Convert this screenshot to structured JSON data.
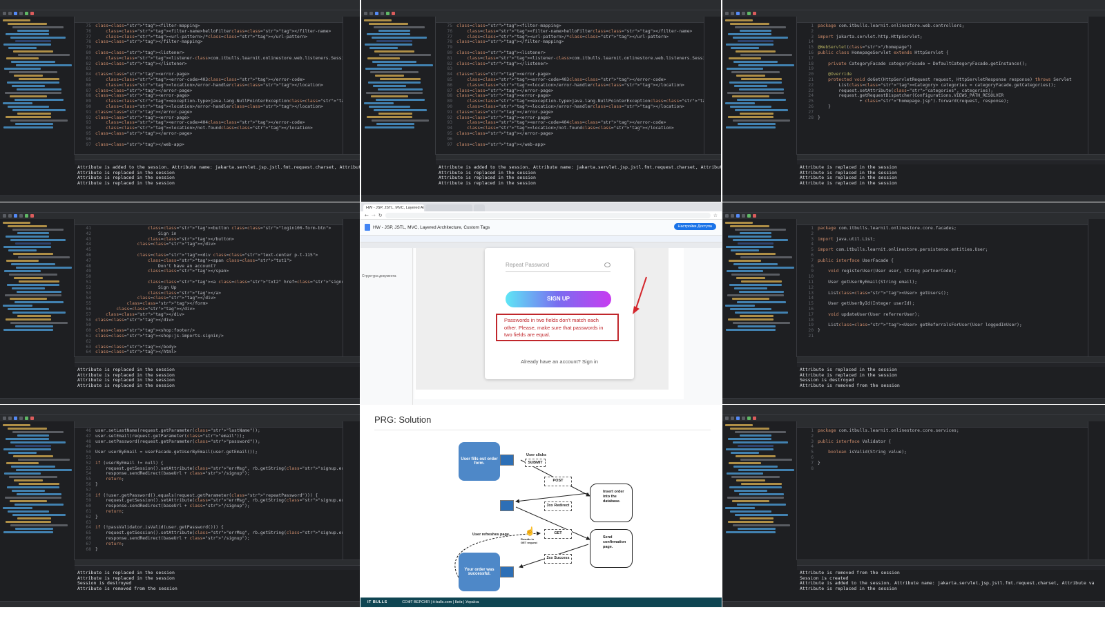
{
  "panels": {
    "ide1": {
      "code": [
        {
          "n": "75",
          "t": "<filter-mapping>"
        },
        {
          "n": "76",
          "t": "    <filter-name>helloFilter</filter-name>"
        },
        {
          "n": "77",
          "t": "    <url-pattern>/*</url-pattern>"
        },
        {
          "n": "78",
          "t": "</filter-mapping>"
        },
        {
          "n": "79",
          "t": ""
        },
        {
          "n": "80",
          "t": "<listener>"
        },
        {
          "n": "81",
          "t": "    <listener-class>com.itbulls.learnit.onlinestore.web.listeners.SessionListener</listener-c"
        },
        {
          "n": "82",
          "t": "</listener>"
        },
        {
          "n": "83",
          "t": ""
        },
        {
          "n": "84",
          "t": "<error-page>"
        },
        {
          "n": "85",
          "t": "    <error-code>403</error-code>"
        },
        {
          "n": "86",
          "t": "    <location>/error-handler</location>"
        },
        {
          "n": "87",
          "t": "</error-page>"
        },
        {
          "n": "88",
          "t": "<error-page>"
        },
        {
          "n": "89",
          "t": "    <exception-type>java.lang.NullPointerException</exception-type>"
        },
        {
          "n": "90",
          "t": "    <location>/error-handler</location>"
        },
        {
          "n": "91",
          "t": "</error-page>"
        },
        {
          "n": "92",
          "t": "<error-page>"
        },
        {
          "n": "93",
          "t": "    <error-code>404</error-code>"
        },
        {
          "n": "94",
          "t": "    <location>/not-found</location>"
        },
        {
          "n": "95",
          "t": "</error-page>"
        },
        {
          "n": "96",
          "t": ""
        },
        {
          "n": "97",
          "t": "</web-app>"
        }
      ],
      "console": [
        "Attribute is added to the session. Attribute name: jakarta.servlet.jsp.jstl.fmt.request.charset, Attribute val",
        "Attribute is replaced in the session",
        "Attribute is replaced in the session",
        "Attribute is replaced in the session"
      ]
    },
    "ide2": {
      "code": [
        {
          "n": "75",
          "t": "<filter-mapping>"
        },
        {
          "n": "76",
          "t": "    <filter-name>helloFilter</filter-name>"
        },
        {
          "n": "77",
          "t": "    <url-pattern>/*</url-pattern>"
        },
        {
          "n": "78",
          "t": "</filter-mapping>"
        },
        {
          "n": "79",
          "t": ""
        },
        {
          "n": "80",
          "t": "<listener>"
        },
        {
          "n": "81",
          "t": "    <listener-class>com.itbulls.learnit.onlinestore.web.listeners.SessionListener</listener-c"
        },
        {
          "n": "82",
          "t": "</listener>"
        },
        {
          "n": "83",
          "t": ""
        },
        {
          "n": "84",
          "t": "<error-page>"
        },
        {
          "n": "85",
          "t": "    <error-code>403</error-code>"
        },
        {
          "n": "86",
          "t": "    <location>/error-handler</location>"
        },
        {
          "n": "87",
          "t": "</error-page>"
        },
        {
          "n": "88",
          "t": "<error-page>"
        },
        {
          "n": "89",
          "t": "    <exception-type>java.lang.NullPointerException</exception-type>"
        },
        {
          "n": "90",
          "t": "    <location>/error-handler</location>"
        },
        {
          "n": "91",
          "t": "</error-page>"
        },
        {
          "n": "92",
          "t": "<error-page>"
        },
        {
          "n": "93",
          "t": "    <error-code>404</error-code>"
        },
        {
          "n": "94",
          "t": "    <location>/not-found</location>"
        },
        {
          "n": "95",
          "t": "</error-page>"
        },
        {
          "n": "96",
          "t": ""
        },
        {
          "n": "97",
          "t": "</web-app>"
        }
      ],
      "console": [
        "Attribute is added to the session. Attribute name: jakarta.servlet.jsp.jstl.fmt.request.charset, Attribute val",
        "Attribute is replaced in the session",
        "Attribute is replaced in the session",
        "Attribute is replaced in the session"
      ]
    },
    "ide3": {
      "code": [
        {
          "n": "1",
          "t": "package com.itbulls.learnit.onlinestore.web.controllers;"
        },
        {
          "n": "2",
          "t": ""
        },
        {
          "n": "3",
          "t": "import jakarta.servlet.http.HttpServlet;"
        },
        {
          "n": "14",
          "t": ""
        },
        {
          "n": "15",
          "t": "@WebServlet(\"/homepage\")"
        },
        {
          "n": "16",
          "t": "public class HomepageServlet extends HttpServlet {"
        },
        {
          "n": "17",
          "t": ""
        },
        {
          "n": "18",
          "t": "    private CategoryFacade categoryFacade = DefaultCategoryFacade.getInstance();"
        },
        {
          "n": "19",
          "t": ""
        },
        {
          "n": "20",
          "t": "    @Override"
        },
        {
          "n": "21",
          "t": "    protected void doGet(HttpServletRequest request, HttpServletResponse response) throws Servlet"
        },
        {
          "n": "22",
          "t": "        List<Category> categories = categoryFacade.getCategories();"
        },
        {
          "n": "23",
          "t": "        request.setAttribute(\"categories\", categories);"
        },
        {
          "n": "24",
          "t": "        request.getRequestDispatcher(Configurations.VIEWS_PATH_RESOLVER"
        },
        {
          "n": "25",
          "t": "                + \"homepage.jsp\").forward(request, response);"
        },
        {
          "n": "26",
          "t": "    }"
        },
        {
          "n": "27",
          "t": ""
        },
        {
          "n": "28",
          "t": "}"
        }
      ],
      "console": [
        "Attribute is replaced in the session",
        "Attribute is replaced in the session",
        "Attribute is replaced in the session",
        "Attribute is replaced in the session"
      ]
    },
    "ide4": {
      "code": [
        {
          "n": "41",
          "t": "                    <button class=\"login100-form-btn\">"
        },
        {
          "n": "42",
          "t": "                        Sign in"
        },
        {
          "n": "43",
          "t": "                    </button>"
        },
        {
          "n": "44",
          "t": "                </div>"
        },
        {
          "n": "45",
          "t": ""
        },
        {
          "n": "46",
          "t": "                <div class=\"text-center p-t-115\">"
        },
        {
          "n": "47",
          "t": "                    <span class=\"txt1\">"
        },
        {
          "n": "48",
          "t": "                        Don't have an account?"
        },
        {
          "n": "49",
          "t": "                    </span>"
        },
        {
          "n": "50",
          "t": ""
        },
        {
          "n": "51",
          "t": "                    <a class=\"txt2\" href=\"signup.html\">"
        },
        {
          "n": "52",
          "t": "                        Sign Up"
        },
        {
          "n": "53",
          "t": "                    </a>"
        },
        {
          "n": "54",
          "t": "                </div>"
        },
        {
          "n": "55",
          "t": "            </form>"
        },
        {
          "n": "56",
          "t": "        </div>"
        },
        {
          "n": "57",
          "t": "    </div>"
        },
        {
          "n": "58",
          "t": "</div>"
        },
        {
          "n": "59",
          "t": ""
        },
        {
          "n": "60",
          "t": "<shop:footer/>"
        },
        {
          "n": "61",
          "t": "<shop:js-imports-signin/>"
        },
        {
          "n": "62",
          "t": ""
        },
        {
          "n": "63",
          "t": "</body>"
        },
        {
          "n": "64",
          "t": "</html>"
        }
      ],
      "console": [
        "Attribute is replaced in the session",
        "Attribute is replaced in the session",
        "Attribute is replaced in the session",
        "Attribute is replaced in the session"
      ]
    },
    "ide5": {
      "code": [
        {
          "n": "1",
          "t": "package com.itbulls.learnit.onlinestore.core.facades;"
        },
        {
          "n": "2",
          "t": ""
        },
        {
          "n": "3",
          "t": "import java.util.List;"
        },
        {
          "n": "4",
          "t": ""
        },
        {
          "n": "5",
          "t": "import com.itbulls.learnit.onlinestore.persistence.entities.User;"
        },
        {
          "n": "6",
          "t": ""
        },
        {
          "n": "7",
          "t": "public interface UserFacade {"
        },
        {
          "n": "8",
          "t": ""
        },
        {
          "n": "9",
          "t": "    void registerUser(User user, String partnerCode);"
        },
        {
          "n": "10",
          "t": ""
        },
        {
          "n": "11",
          "t": "    User getUserByEmail(String email);"
        },
        {
          "n": "12",
          "t": ""
        },
        {
          "n": "13",
          "t": "    List<User> getUsers();"
        },
        {
          "n": "14",
          "t": ""
        },
        {
          "n": "15",
          "t": "    User getUserById(Integer userId);"
        },
        {
          "n": "16",
          "t": ""
        },
        {
          "n": "17",
          "t": "    void updateUser(User referrerUser);"
        },
        {
          "n": "18",
          "t": ""
        },
        {
          "n": "19",
          "t": "    List<User> getReferralsForUser(User loggedInUser);"
        },
        {
          "n": "20",
          "t": "}"
        },
        {
          "n": "21",
          "t": ""
        }
      ],
      "console": [
        "Attribute is replaced in the session",
        "Attribute is replaced in the session",
        "Session is destroyed",
        "Attribute is removed from the session"
      ]
    },
    "ide6": {
      "code": [
        {
          "n": "46",
          "t": "user.setLastName(request.getParameter(\"lastName\"));"
        },
        {
          "n": "47",
          "t": "user.setEmail(request.getParameter(\"email\"));"
        },
        {
          "n": "48",
          "t": "user.setPassword(request.getParameter(\"password\"));"
        },
        {
          "n": "49",
          "t": ""
        },
        {
          "n": "50",
          "t": "User userByEmail = userFacade.getUserByEmail(user.getEmail());"
        },
        {
          "n": "51",
          "t": ""
        },
        {
          "n": "52",
          "t": "if (userByEmail != null) {"
        },
        {
          "n": "53",
          "t": "    request.getSession().setAttribute(\"errMsg\", rb.getString(\"signup.err.msg.email.exists\"));"
        },
        {
          "n": "54",
          "t": "    response.sendRedirect(baseUrl + \"/signup\");"
        },
        {
          "n": "55",
          "t": "    return;"
        },
        {
          "n": "56",
          "t": "}"
        },
        {
          "n": "57",
          "t": ""
        },
        {
          "n": "58",
          "t": "if (!user.getPassword().equals(request.getParameter(\"repeatPassword\"))) {"
        },
        {
          "n": "59",
          "t": "    request.getSession().setAttribute(\"errMsg\", rb.getString(\"signup.err.msg.repeat.password\"));"
        },
        {
          "n": "60",
          "t": "    response.sendRedirect(baseUrl + \"/signup\");"
        },
        {
          "n": "61",
          "t": "    return;"
        },
        {
          "n": "62",
          "t": "}"
        },
        {
          "n": "63",
          "t": ""
        },
        {
          "n": "64",
          "t": "if (!passValidator.isValid(user.getPassword())) {"
        },
        {
          "n": "65",
          "t": "    request.getSession().setAttribute(\"errMsg\", rb.getString(\"signup.err.msg.special.character\"));"
        },
        {
          "n": "66",
          "t": "    response.sendRedirect(baseUrl + \"/signup\");"
        },
        {
          "n": "67",
          "t": "    return;"
        },
        {
          "n": "68",
          "t": "}"
        }
      ],
      "console": [
        "Attribute is replaced in the session",
        "Attribute is replaced in the session",
        "Session is destroyed",
        "Attribute is removed from the session"
      ]
    },
    "ide7": {
      "code": [
        {
          "n": "1",
          "t": "package com.itbulls.learnit.onlinestore.core.services;"
        },
        {
          "n": "2",
          "t": ""
        },
        {
          "n": "3",
          "t": "public interface Validator {"
        },
        {
          "n": "4",
          "t": ""
        },
        {
          "n": "5",
          "t": "    boolean isValid(String value);"
        },
        {
          "n": "6",
          "t": ""
        },
        {
          "n": "7",
          "t": "}"
        },
        {
          "n": "8",
          "t": ""
        }
      ],
      "console": [
        "Attribute is removed from the session",
        "Session is created",
        "Attribute is added to the session. Attribute name: jakarta.servlet.jsp.jstl.fmt.request.charset, Attribute va",
        "Attribute is replaced in the session"
      ]
    }
  },
  "browser": {
    "tab1": "HW - JSP, JSTL, MVC, Layered Architecture, Custom Tags",
    "doc_title": "HW - JSP, JSTL, MVC, Layered Architecture, Custom Tags",
    "share_label": "Настройки Доступа",
    "outline_label": "Структура документа",
    "repeat_password_placeholder": "Repeat Password",
    "signup_button": "SIGN UP",
    "error_message": "Passwords in two fields don't match each other. Please, make sure that passwords in two fields are equal.",
    "already_account": "Already have an account? Sign in"
  },
  "slide": {
    "title": "PRG: Solution",
    "user_fills": "User fills out order form.",
    "user_clicks": "User clicks",
    "submit": "SUBMIT",
    "post": "POST",
    "redirect": "3xx Redirect",
    "insert_order": "Insert order into the database.",
    "get": "GET",
    "refresh": "User refreshes page.",
    "results_in": "Results in GET request",
    "success": "2xx Success",
    "send_confirmation": "Send confirmation page.",
    "order_success": "Your order was successful.",
    "footer_brand": "IT BULLS",
    "footer_text": "СОФТ ВЕРСИЯ | it-bulls.com | Київ | Україна"
  }
}
